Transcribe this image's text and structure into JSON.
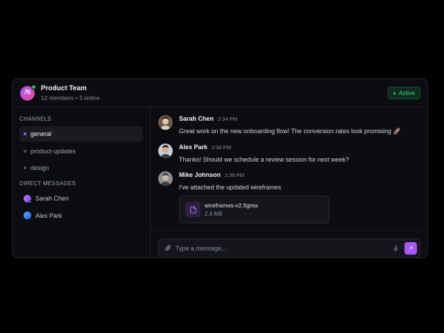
{
  "header": {
    "team_name": "Product Team",
    "team_meta": "12 members • 3 online",
    "status": "Active"
  },
  "sidebar": {
    "channels_title": "CHANNELS",
    "channels": [
      {
        "label": "general",
        "active": true
      },
      {
        "label": "product-updates",
        "active": false
      },
      {
        "label": "design",
        "active": false
      }
    ],
    "dm_title": "DIRECT MESSAGES",
    "direct_messages": [
      {
        "label": "Sarah Chen"
      },
      {
        "label": "Alex Park"
      }
    ]
  },
  "messages": [
    {
      "author": "Sarah Chen",
      "time": "2:34 PM",
      "text": "Great work on the new onboarding flow! The conversion rates look promising 🚀"
    },
    {
      "author": "Alex Park",
      "time": "2:35 PM",
      "text": "Thanks! Should we schedule a review session for next week?"
    },
    {
      "author": "Mike Johnson",
      "time": "2:36 PM",
      "text": "I've attached the updated wireframes"
    }
  ],
  "attachment": {
    "name": "wireframes-v2.figma",
    "size": "2.4 MB"
  },
  "composer": {
    "placeholder": "Type a message..."
  },
  "colors": {
    "accent": "#a855f7",
    "online": "#22c55e",
    "background": "#0c0d11"
  },
  "icons": [
    "users-icon",
    "paperclip-icon",
    "microphone-icon",
    "send-icon",
    "file-icon"
  ]
}
